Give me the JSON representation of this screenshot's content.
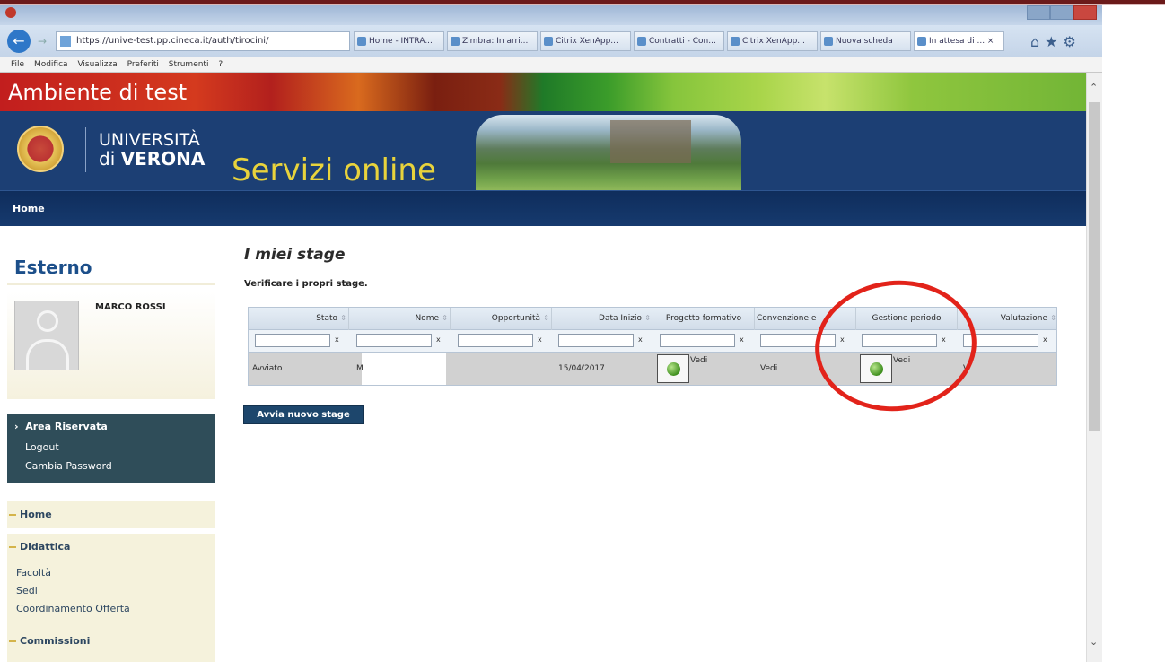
{
  "browser": {
    "address": "https://unive-test.pp.cineca.it/auth/tirocini/",
    "tabs": [
      {
        "label": "Home - INTRA..."
      },
      {
        "label": "Zimbra: In arri..."
      },
      {
        "label": "Citrix XenApp..."
      },
      {
        "label": "Contratti - Con..."
      },
      {
        "label": "Citrix XenApp..."
      },
      {
        "label": "Nuova scheda"
      },
      {
        "label": "In attesa di ... ×"
      }
    ],
    "menu": [
      "File",
      "Modifica",
      "Visualizza",
      "Preferiti",
      "Strumenti",
      "?"
    ]
  },
  "header": {
    "env_title": "Ambiente di test",
    "uni_line1": "UNIVERSITÀ",
    "uni_line2_prefix": "di",
    "uni_line2_bold": "VERONA",
    "site_title": "Servizi online",
    "nav_home": "Home"
  },
  "sidebar": {
    "role": "Esterno",
    "user_name": "MARCO ROSSI",
    "area_title": "Area Riservata",
    "area_links": [
      "Logout",
      "Cambia Password"
    ],
    "menu_home": "Home",
    "menu_didattica": "Didattica",
    "didattica_items": [
      "Facoltà",
      "Sedi",
      "Coordinamento Offerta"
    ],
    "menu_commissioni": "Commissioni"
  },
  "main": {
    "title": "I miei stage",
    "subtitle": "Verificare i propri stage.",
    "columns": [
      "Stato",
      "Nome",
      "Opportunità",
      "Data Inizio",
      "Progetto formativo",
      "Convenzione e",
      "Gestione periodo",
      "Valutazione"
    ],
    "row": {
      "stato": "Avviato",
      "nome": "M",
      "data_inizio": "15/04/2017",
      "progetto_label": "Vedi",
      "convenzione": "Vedi",
      "gestione_label": "Vedi",
      "valutazione": "V"
    },
    "new_stage_button": "Avvia nuovo stage"
  },
  "colors": {
    "header_blue": "#1c3f74",
    "site_title": "#e8d33c",
    "highlight_circle": "#e2231a",
    "button_dark": "#1d466c"
  }
}
